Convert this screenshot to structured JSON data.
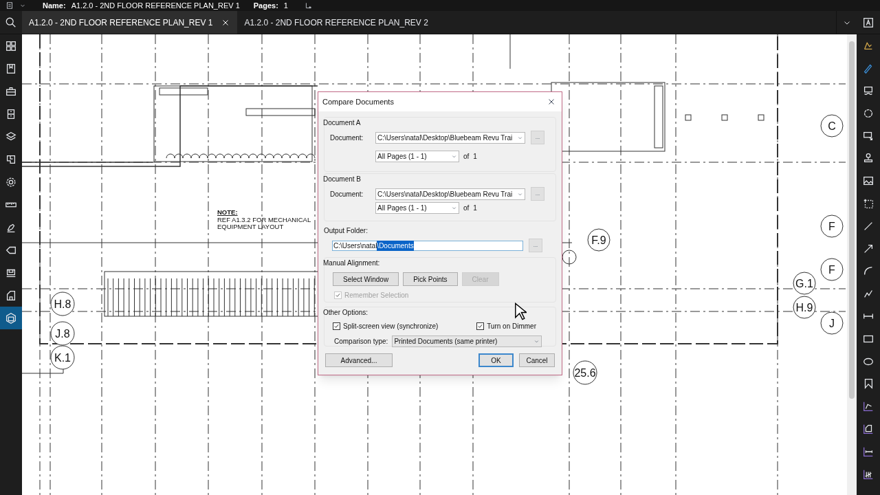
{
  "document_bar": {
    "name_label": "Name:",
    "name": "A1.2.0 - 2ND FLOOR REFERENCE PLAN_REV 1",
    "pages_label": "Pages:",
    "pages": "1"
  },
  "tabs": [
    {
      "label": "A1.2.0 - 2ND FLOOR REFERENCE PLAN_REV 1",
      "selected": true,
      "closable": true
    },
    {
      "label": "A1.2.0 - 2ND FLOOR REFERENCE PLAN_REV 2",
      "selected": false,
      "closable": false
    }
  ],
  "left_toolbar": [
    {
      "selected": false
    },
    {
      "selected": false
    },
    {
      "selected": false
    },
    {
      "selected": false
    },
    {
      "selected": false
    },
    {
      "selected": false
    },
    {
      "selected": false
    },
    {
      "selected": false
    },
    {
      "selected": false
    },
    {
      "selected": false
    },
    {
      "selected": false
    },
    {
      "selected": false
    },
    {
      "selected": true
    }
  ],
  "drawing": {
    "note_title": "NOTE:",
    "note_lines": [
      "REF A1.3.2 FOR MECHANICAL",
      "EQUIPMENT LAYOUT"
    ],
    "grid_labels": [
      {
        "text": "H.8"
      },
      {
        "text": "J.8"
      },
      {
        "text": "K.1"
      },
      {
        "text": "F.9"
      },
      {
        "text": "G.1"
      },
      {
        "text": "H.9"
      },
      {
        "text": "25.6"
      },
      {
        "text": "C"
      },
      {
        "text": "F"
      },
      {
        "text": "F"
      },
      {
        "text": "J"
      }
    ]
  },
  "dialog": {
    "title": "Compare Documents",
    "documents": [
      {
        "heading": "Document A",
        "document_label": "Document:",
        "path": "C:\\Users\\natal\\Desktop\\Bluebeam Revu Trai",
        "browse": "...",
        "pages": "All Pages (1 - 1)",
        "of_label": "of",
        "page_count": "1"
      },
      {
        "heading": "Document B",
        "document_label": "Document:",
        "path": "C:\\Users\\natal\\Desktop\\Bluebeam Revu Trai",
        "browse": "...",
        "pages": "All Pages (1 - 1)",
        "of_label": "of",
        "page_count": "1"
      }
    ],
    "output_folder": {
      "label": "Output Folder:",
      "value": "C:\\Users\\natal",
      "selected_text": "\\Documents",
      "browse": "..."
    },
    "manual_alignment": {
      "label": "Manual Alignment:",
      "buttons": [
        {
          "label": "Select Window",
          "disabled": false
        },
        {
          "label": "Pick Points",
          "disabled": false
        },
        {
          "label": "Clear",
          "disabled": true
        }
      ],
      "remember": {
        "label": "Remember Selection",
        "checked": true,
        "disabled": true
      }
    },
    "other_options": {
      "label": "Other Options:",
      "checkboxes": [
        {
          "label": "Split-screen view (synchronize)",
          "checked": true
        },
        {
          "label": "Turn on Dimmer",
          "checked": true
        }
      ],
      "comparison_label": "Comparison type:",
      "comparison_value": "Printed Documents (same printer)"
    },
    "buttons": {
      "advanced": "Advanced...",
      "ok": "OK",
      "cancel": "Cancel"
    }
  }
}
